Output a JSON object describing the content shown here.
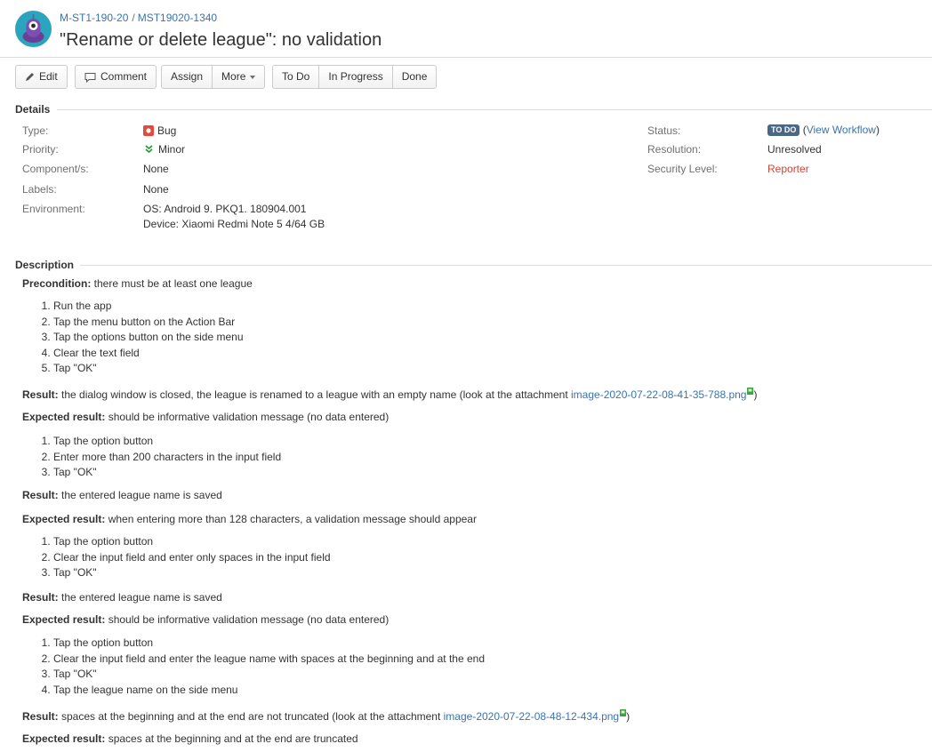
{
  "header": {
    "breadcrumb_project": "M-ST1-190-20",
    "breadcrumb_separator": "/",
    "breadcrumb_issue": "MST19020-1340",
    "title": "\"Rename or delete league\": no validation"
  },
  "toolbar": {
    "edit": "Edit",
    "comment": "Comment",
    "assign": "Assign",
    "more": "More",
    "todo": "To Do",
    "in_progress": "In Progress",
    "done": "Done"
  },
  "details": {
    "heading": "Details",
    "type_label": "Type:",
    "type_value": "Bug",
    "priority_label": "Priority:",
    "priority_value": "Minor",
    "components_label": "Component/s:",
    "components_value": "None",
    "labels_label": "Labels:",
    "labels_value": "None",
    "environment_label": "Environment:",
    "environment_line1": "OS: Android 9. PKQ1. 180904.001",
    "environment_line2": "Device: Xiaomi Redmi Note 5 4/64 GB",
    "status_label": "Status:",
    "status_value": "TO DO",
    "status_link": "View Workflow",
    "resolution_label": "Resolution:",
    "resolution_value": "Unresolved",
    "security_label": "Security Level:",
    "security_value": "Reporter"
  },
  "description": {
    "heading": "Description",
    "precondition_label": "Precondition:",
    "precondition_text": " there must be at least one league",
    "list1": [
      "Run the app",
      "Tap the menu button on the Action Bar",
      "Tap the options button on the side menu",
      "Clear the text field",
      "Tap \"OK\""
    ],
    "result1_label": "Result:",
    "result1_text": " the dialog window is closed, the league is renamed to a league with an empty name (look at the attachment ",
    "result1_link": "image-2020-07-22-08-41-35-788.png",
    "result1_close": ")",
    "expected1_label": "Expected result:",
    "expected1_text": " should be informative validation message (no data entered)",
    "list2": [
      "Tap the option button",
      "Enter more than 200 characters in the input field",
      "Tap \"OK\""
    ],
    "result2_label": "Result:",
    "result2_text": " the entered league name is saved",
    "expected2_label": "Expected result:",
    "expected2_text": " when entering more than 128 characters, a validation message should appear",
    "list3": [
      "Tap the option button",
      "Clear the input field and enter only spaces in the input field",
      "Tap \"OK\""
    ],
    "result3_label": "Result:",
    "result3_text": " the entered league name is saved",
    "expected3_label": "Expected result:",
    "expected3_text": " should be informative validation message (no data entered)",
    "list4": [
      "Tap the option button",
      "Clear the input field and enter the league name with spaces at the beginning and at the end",
      "Tap \"OK\"",
      "Tap the league name on the side menu"
    ],
    "result4_label": "Result:",
    "result4_text": " spaces at the beginning and at the end are not truncated (look at the attachment ",
    "result4_link": "image-2020-07-22-08-48-12-434.png",
    "result4_close": ")",
    "expected4_label": "Expected result:",
    "expected4_text": " spaces at the beginning and at the end are truncated"
  },
  "colors": {
    "link": "#3b73af",
    "status_lozenge": "#4a6785",
    "security_red": "#d04437",
    "bug_icon": "#e5493a",
    "priority_green": "#2b9b40",
    "avatar": "#2ba4bd"
  }
}
